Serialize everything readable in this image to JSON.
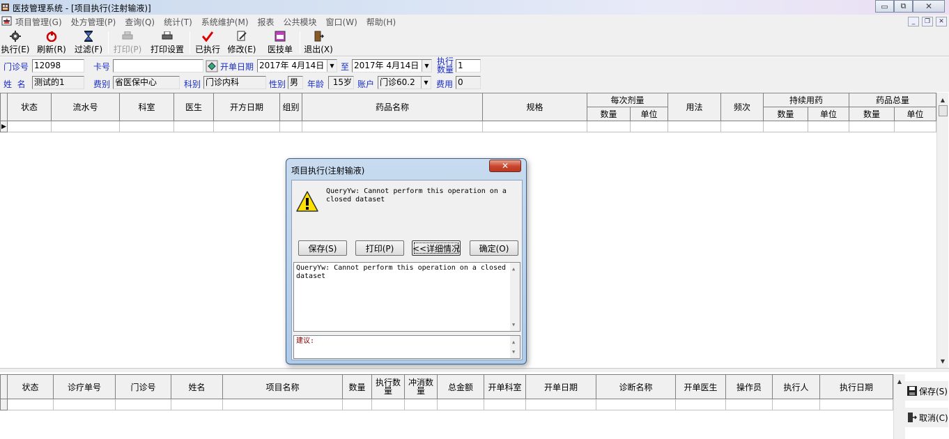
{
  "window": {
    "title": "医技管理系统 - [项目执行(注射输液)]"
  },
  "menu": {
    "items": [
      "项目管理(G)",
      "处方管理(P)",
      "查询(Q)",
      "统计(T)",
      "系统维护(M)",
      "报表",
      "公共模块",
      "窗口(W)",
      "帮助(H)"
    ]
  },
  "toolbar": {
    "execute": "执行(E)",
    "refresh": "刷新(R)",
    "filter": "过滤(F)",
    "print": "打印(P)",
    "print_settings": "打印设置",
    "executed": "已执行",
    "modify": "修改(E)",
    "medtech_form": "医技单",
    "exit": "退出(X)"
  },
  "form": {
    "clinic_no_label": "门诊号",
    "clinic_no_value": "12098",
    "card_no_label": "卡号",
    "card_no_value": "",
    "open_date_label": "开单日期",
    "date_from": "2017年 4月14日",
    "to_label": "至",
    "date_to": "2017年 4月14日",
    "exec_qty_label_1": "执行",
    "exec_qty_label_2": "数量",
    "exec_qty_value": "1",
    "name_label": "姓  名",
    "name_value": "测试的1",
    "fee_type_label": "费别",
    "fee_type_value": "省医保中心",
    "dept_label": "科别",
    "dept_value": "门诊内科",
    "gender_label": "性别",
    "gender_value": "男",
    "age_label": "年龄",
    "age_value": "15岁",
    "account_label": "账户",
    "account_value": "门诊60.2",
    "fee_label": "费用",
    "fee_value": "0"
  },
  "top_grid": {
    "columns": [
      "状态",
      "流水号",
      "科室",
      "医生",
      "开方日期",
      "组别",
      "药品名称",
      "规格"
    ],
    "group_each_dose": "每次剂量",
    "group_each_dose_sub": [
      "数量",
      "单位"
    ],
    "col_usage": "用法",
    "col_freq": "频次",
    "group_continuous": "持续用药",
    "group_continuous_sub": [
      "数量",
      "单位"
    ],
    "group_total": "药品总量",
    "group_total_sub": [
      "数量",
      "单位"
    ]
  },
  "bottom_grid": {
    "columns": [
      "状态",
      "诊疗单号",
      "门诊号",
      "姓名",
      "项目名称",
      "数量",
      "执行数量",
      "冲消数量",
      "总金额",
      "开单科室",
      "开单日期",
      "诊断名称",
      "开单医生",
      "操作员",
      "执行人",
      "执行日期"
    ]
  },
  "side_buttons": {
    "save": "保存(S)",
    "cancel": "取消(C)"
  },
  "dialog": {
    "title": "项目执行(注射输液)",
    "message": "QueryYw: Cannot perform this operation on a closed dataset",
    "buttons": {
      "save": "保存(S)",
      "print": "打印(P)",
      "details": "<<详细情况",
      "ok": "确定(O)"
    },
    "detail_text": "QueryYw: Cannot perform this operation on a closed dataset",
    "suggestion_label": "建议:"
  }
}
